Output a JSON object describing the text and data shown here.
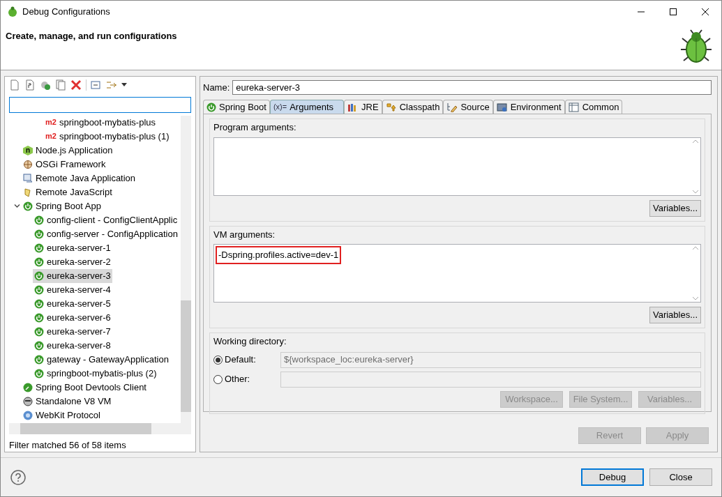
{
  "window": {
    "title": "Debug Configurations"
  },
  "header": {
    "title": "Create, manage, and run configurations"
  },
  "sidebar": {
    "tree": [
      {
        "children": [
          {
            "label": "springboot-mybatis-plus",
            "kind": "m2",
            "badge": "m2",
            "selected": false
          },
          {
            "label": "springboot-mybatis-plus (1)",
            "kind": "m2",
            "badge": "m2",
            "selected": false
          }
        ]
      },
      {
        "label": "Node.js Application",
        "kind": "node",
        "badge": "n",
        "selected": false
      },
      {
        "label": "OSGi Framework",
        "kind": "osgi",
        "selected": false
      },
      {
        "label": "Remote Java Application",
        "kind": "remote-java",
        "selected": false
      },
      {
        "label": "Remote JavaScript",
        "kind": "remote-js",
        "selected": false
      },
      {
        "label": "Spring Boot App",
        "kind": "spring",
        "selected": false,
        "expanded": true,
        "children": [
          {
            "label": "config-client - ConfigClientApplic",
            "kind": "spring",
            "selected": false
          },
          {
            "label": "config-server - ConfigApplication",
            "kind": "spring",
            "selected": false
          },
          {
            "label": "eureka-server-1",
            "kind": "spring",
            "selected": false
          },
          {
            "label": "eureka-server-2",
            "kind": "spring",
            "selected": false
          },
          {
            "label": "eureka-server-3",
            "kind": "spring",
            "selected": true
          },
          {
            "label": "eureka-server-4",
            "kind": "spring",
            "selected": false
          },
          {
            "label": "eureka-server-5",
            "kind": "spring",
            "selected": false
          },
          {
            "label": "eureka-server-6",
            "kind": "spring",
            "selected": false
          },
          {
            "label": "eureka-server-7",
            "kind": "spring",
            "selected": false
          },
          {
            "label": "eureka-server-8",
            "kind": "spring",
            "selected": false
          },
          {
            "label": "gateway - GatewayApplication",
            "kind": "spring",
            "selected": false
          },
          {
            "label": "springboot-mybatis-plus (2)",
            "kind": "spring",
            "selected": false
          }
        ]
      },
      {
        "label": "Spring Boot Devtools Client",
        "kind": "devtools",
        "selected": false
      },
      {
        "label": "Standalone V8 VM",
        "kind": "v8",
        "selected": false
      },
      {
        "label": "WebKit Protocol",
        "kind": "webkit",
        "selected": false
      }
    ],
    "status": "Filter matched 56 of 58 items"
  },
  "name_field": {
    "label": "Name:",
    "value": "eureka-server-3"
  },
  "tabs": [
    {
      "label": "Spring Boot",
      "kind": "spring",
      "selected": false
    },
    {
      "label": "Arguments",
      "kind": "args",
      "icon_text": "(x)=",
      "selected": true
    },
    {
      "label": "JRE",
      "kind": "jre",
      "selected": false
    },
    {
      "label": "Classpath",
      "kind": "classpath",
      "selected": false
    },
    {
      "label": "Source",
      "kind": "source",
      "selected": false
    },
    {
      "label": "Environment",
      "kind": "environment",
      "selected": false
    },
    {
      "label": "Common",
      "kind": "common",
      "selected": false
    }
  ],
  "program_arguments": {
    "label": "Program arguments:",
    "button": {
      "label": "Variables...",
      "disabled": false
    }
  },
  "vm_arguments": {
    "label": "VM arguments:",
    "value": "-Dspring.profiles.active=dev-1",
    "highlighted": true,
    "button": {
      "label": "Variables...",
      "disabled": false
    }
  },
  "working_directory": {
    "label": "Working directory:",
    "options": [
      {
        "label": "Default:",
        "selected": true,
        "value": "${workspace_loc:eureka-server}"
      },
      {
        "label": "Other:",
        "selected": false
      }
    ],
    "buttons": [
      {
        "label": "Workspace...",
        "disabled": true
      },
      {
        "label": "File System...",
        "disabled": true
      },
      {
        "label": "Variables...",
        "disabled": true
      }
    ]
  },
  "actions": [
    {
      "label": "Revert",
      "disabled": true
    },
    {
      "label": "Apply",
      "disabled": true
    }
  ],
  "footer_buttons": [
    {
      "label": "Debug",
      "default": true
    },
    {
      "label": "Close",
      "default": false
    }
  ]
}
